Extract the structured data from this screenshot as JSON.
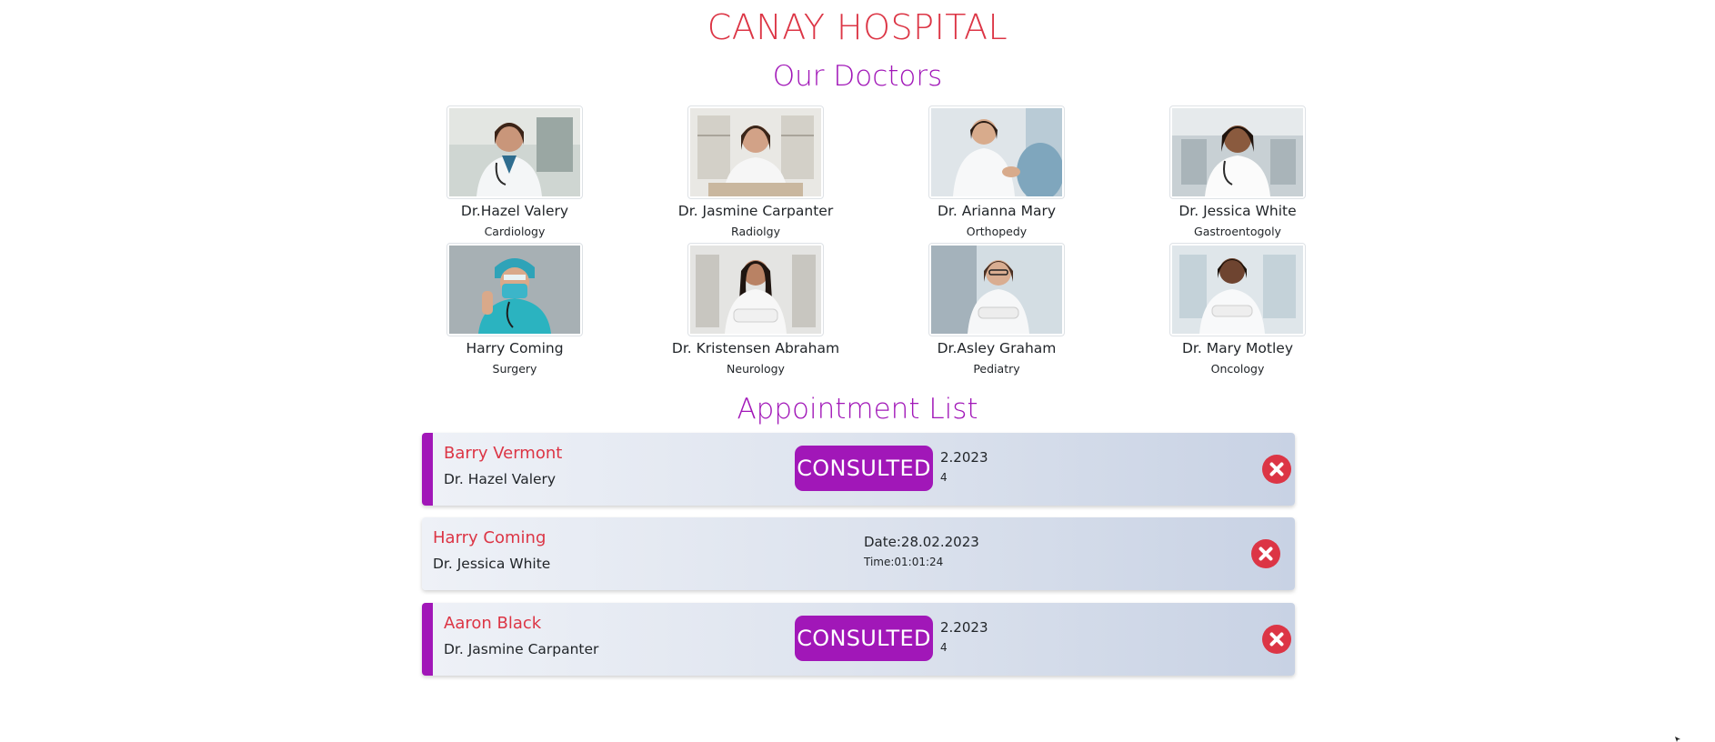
{
  "header": {
    "hospital_name": "CANAY HOSPITAL",
    "doctors_heading": "Our Doctors",
    "appointments_heading": "Appointment List"
  },
  "doctors": [
    {
      "name": "Dr.Hazel Valery",
      "specialty": "Cardiology",
      "photo_icon": "doctor-portrait-icon"
    },
    {
      "name": "Dr. Jasmine Carpanter",
      "specialty": "Radiolgy",
      "photo_icon": "doctor-portrait-icon"
    },
    {
      "name": "Dr. Arianna Mary",
      "specialty": "Orthopedy",
      "photo_icon": "doctor-portrait-icon"
    },
    {
      "name": "Dr. Jessica White",
      "specialty": "Gastroentogoly",
      "photo_icon": "doctor-portrait-icon"
    },
    {
      "name": "Harry Coming",
      "specialty": "Surgery",
      "photo_icon": "surgeon-portrait-icon"
    },
    {
      "name": "Dr. Kristensen Abraham",
      "specialty": "Neurology",
      "photo_icon": "doctor-portrait-icon"
    },
    {
      "name": "Dr.Asley Graham",
      "specialty": "Pediatry",
      "photo_icon": "doctor-portrait-icon"
    },
    {
      "name": "Dr. Mary Motley",
      "specialty": "Oncology",
      "photo_icon": "doctor-portrait-icon"
    }
  ],
  "appointments": [
    {
      "patient": "Barry Vermont",
      "doctor": "Dr. Hazel Valery",
      "date": "2.2023",
      "time": "4",
      "consulted": true,
      "badge": "CONSULTED"
    },
    {
      "patient": "Harry Coming",
      "doctor": "Dr. Jessica White",
      "date": "Date:28.02.2023",
      "time": "Time:01:01:24",
      "consulted": false,
      "badge": ""
    },
    {
      "patient": "Aaron Black",
      "doctor": "Dr. Jasmine Carpanter",
      "date": "2.2023",
      "time": "4",
      "consulted": true,
      "badge": "CONSULTED"
    }
  ],
  "colors": {
    "title_red": "#dc3545",
    "accent_purple": "#a117b8",
    "delete_red": "#dc3545"
  },
  "icons": {
    "delete": "close-circle-icon"
  }
}
